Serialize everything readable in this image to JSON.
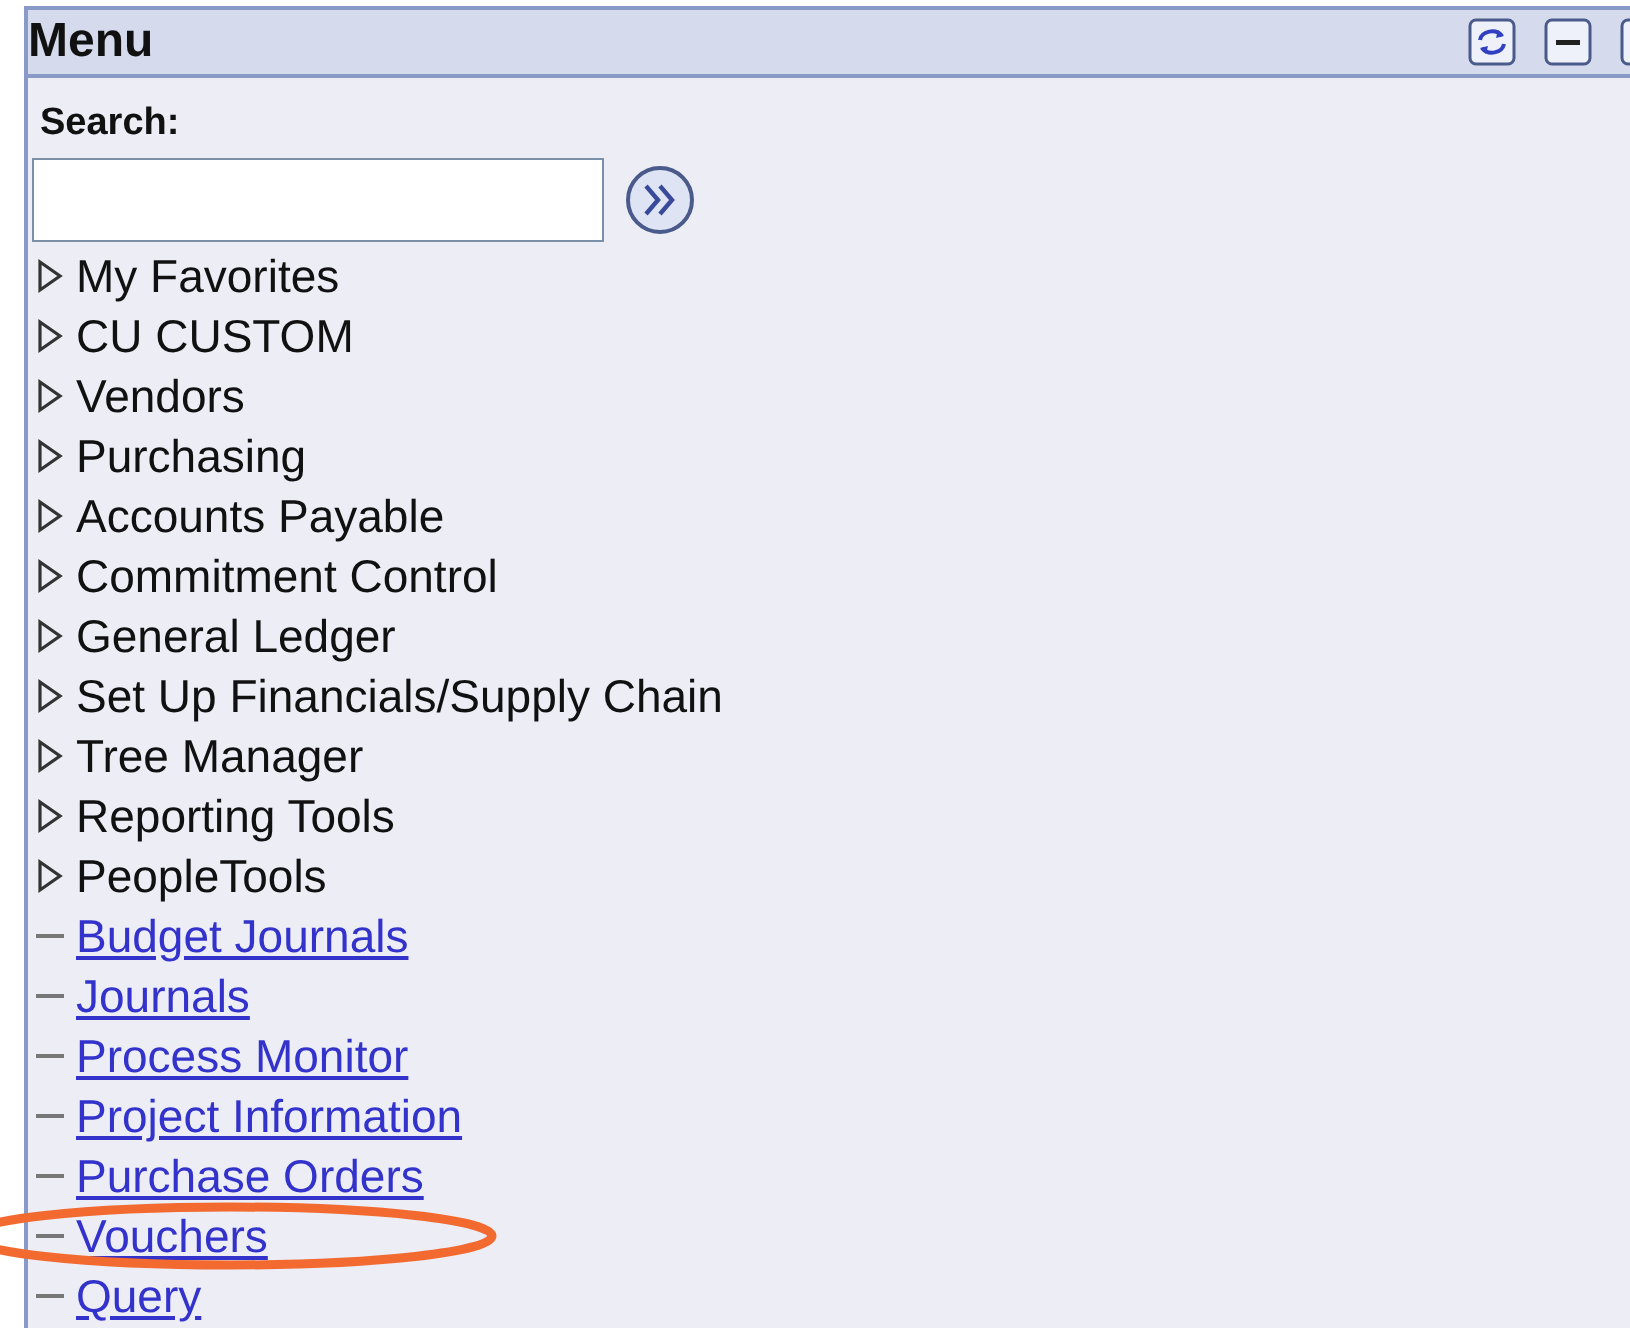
{
  "panel": {
    "title": "Menu"
  },
  "search": {
    "label": "Search:"
  },
  "items": [
    {
      "kind": "folder",
      "label": "My Favorites"
    },
    {
      "kind": "folder",
      "label": "CU CUSTOM"
    },
    {
      "kind": "folder",
      "label": "Vendors"
    },
    {
      "kind": "folder",
      "label": "Purchasing"
    },
    {
      "kind": "folder",
      "label": "Accounts Payable"
    },
    {
      "kind": "folder",
      "label": "Commitment Control"
    },
    {
      "kind": "folder",
      "label": "General Ledger"
    },
    {
      "kind": "folder",
      "label": "Set Up Financials/Supply Chain"
    },
    {
      "kind": "folder",
      "label": "Tree Manager"
    },
    {
      "kind": "folder",
      "label": "Reporting Tools"
    },
    {
      "kind": "folder",
      "label": "PeopleTools"
    },
    {
      "kind": "link",
      "label": "Budget Journals"
    },
    {
      "kind": "link",
      "label": "Journals"
    },
    {
      "kind": "link",
      "label": "Process Monitor"
    },
    {
      "kind": "link",
      "label": "Project Information"
    },
    {
      "kind": "link",
      "label": "Purchase Orders"
    },
    {
      "kind": "link",
      "label": "Vouchers"
    },
    {
      "kind": "link",
      "label": "Query"
    }
  ]
}
